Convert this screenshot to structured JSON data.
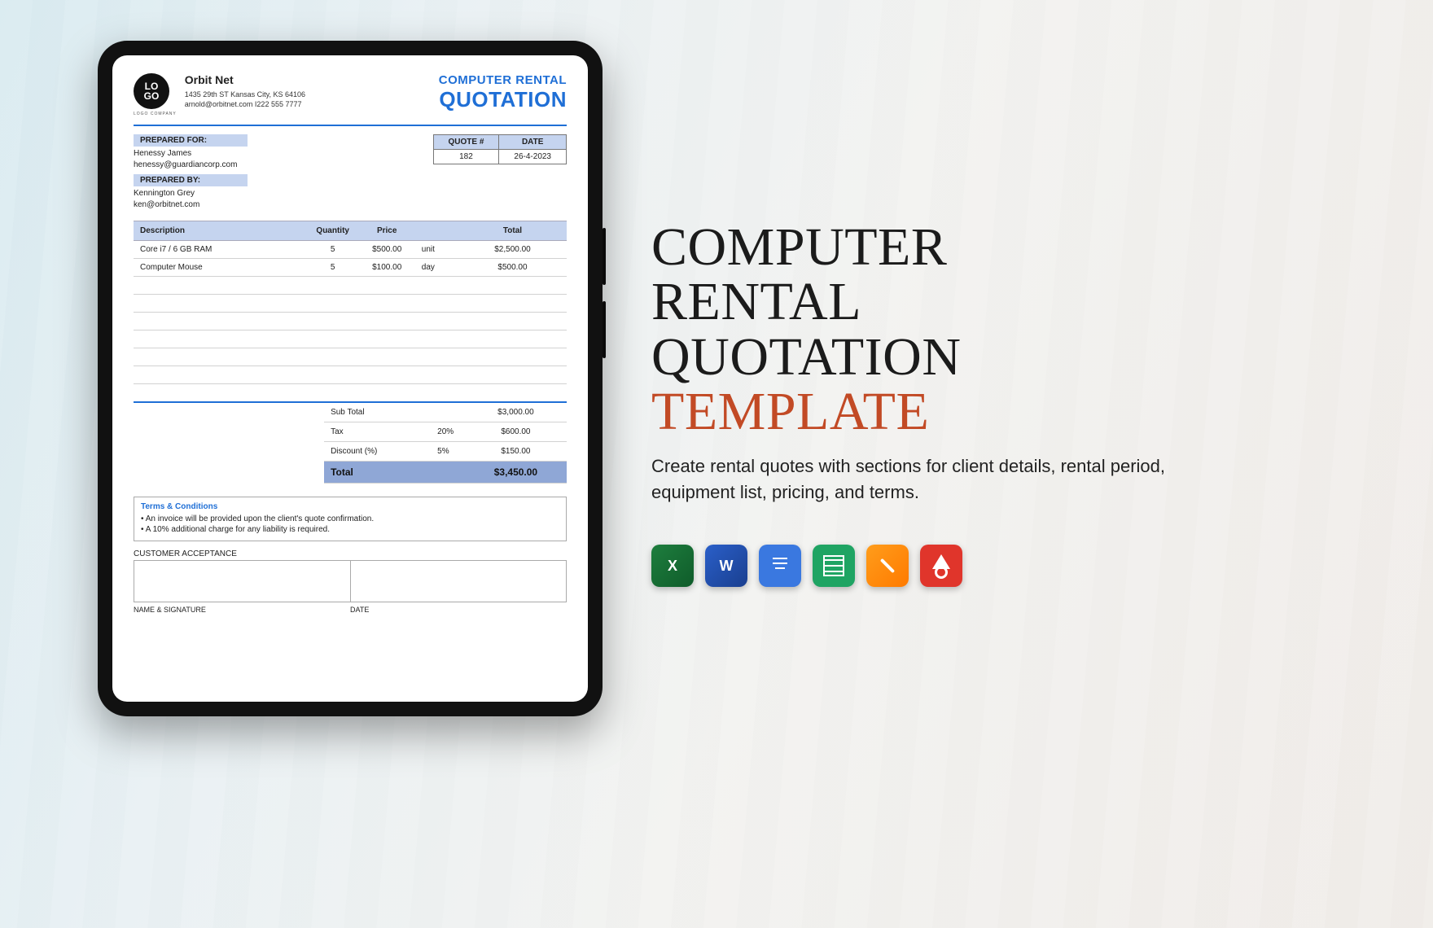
{
  "doc": {
    "company": "Orbit Net",
    "address": "1435 29th ST Kansas City, KS 64106",
    "contact": "arnold@orbitnet.com I222 555 7777",
    "logo_text_top": "LO",
    "logo_text_bot": "GO",
    "logo_sub": "LOGO COMPANY",
    "title1": "COMPUTER RENTAL",
    "title2": "QUOTATION",
    "prepared_for_label": "PREPARED FOR:",
    "prepared_for_name": "Henessy James",
    "prepared_for_email": "henessy@guardiancorp.com",
    "prepared_by_label": "PREPARED BY:",
    "prepared_by_name": "Kennington Grey",
    "prepared_by_email": "ken@orbitnet.com",
    "quote_header_num": "QUOTE #",
    "quote_header_date": "DATE",
    "quote_num": "182",
    "quote_date": "26-4-2023",
    "cols": {
      "desc": "Description",
      "qty": "Quantity",
      "price": "Price",
      "unit_blank": "",
      "total": "Total"
    },
    "items": [
      {
        "desc": "Core i7 / 6 GB RAM",
        "qty": "5",
        "price": "$500.00",
        "unit": "unit",
        "total": "$2,500.00"
      },
      {
        "desc": "Computer Mouse",
        "qty": "5",
        "price": "$100.00",
        "unit": "day",
        "total": "$500.00"
      }
    ],
    "totals": {
      "subtotal_label": "Sub Total",
      "subtotal": "$3,000.00",
      "tax_label": "Tax",
      "tax_pct": "20%",
      "tax": "$600.00",
      "discount_label": "Discount (%)",
      "discount_pct": "5%",
      "discount": "$150.00",
      "grand_label": "Total",
      "grand": "$3,450.00"
    },
    "terms_title": "Terms & Conditions",
    "terms": [
      "• An invoice will be provided upon the client's quote confirmation.",
      "• A 10% additional charge for any liability is required."
    ],
    "accept_label": "CUSTOMER ACCEPTANCE",
    "sig_name": "NAME & SIGNATURE",
    "sig_date": "DATE"
  },
  "promo": {
    "title_l1": "COMPUTER",
    "title_l2": "RENTAL",
    "title_l3": "QUOTATION",
    "title_accent": "TEMPLATE",
    "desc": "Create rental quotes with sections for client details, rental period, equipment list, pricing, and terms.",
    "formats": {
      "excel": "X",
      "word": "W",
      "gdocs": "",
      "gsheet": "",
      "pages": "",
      "pdf": ""
    }
  }
}
